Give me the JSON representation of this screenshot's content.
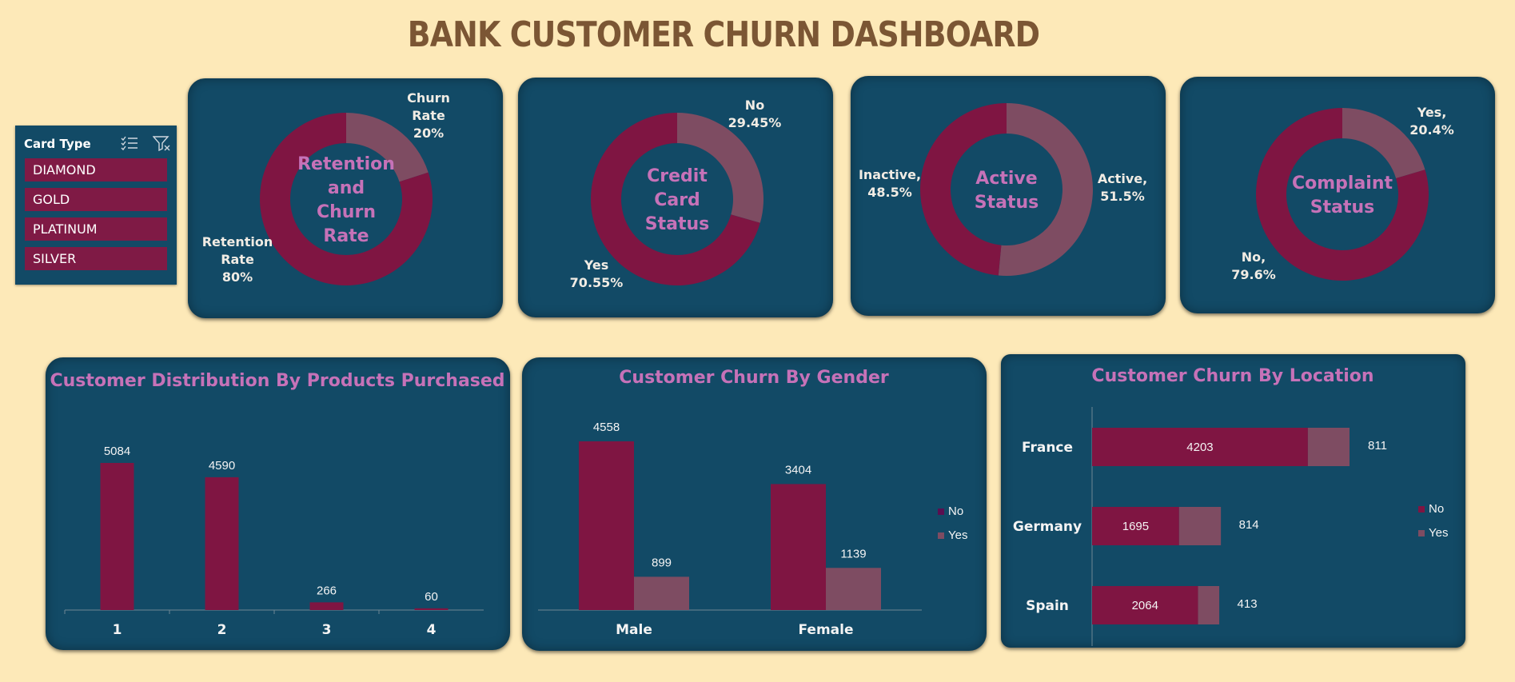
{
  "dashboard": {
    "title": "BANK CUSTOMER CHURN DASHBOARD"
  },
  "colors": {
    "no": "#7f1542",
    "yes": "#7e4c62",
    "panel": "#124a66",
    "accent": "#c672b8",
    "background": "#fde9b8"
  },
  "slicer": {
    "title": "Card Type",
    "icons": [
      "multi-select-icon",
      "clear-filter-icon"
    ],
    "items": [
      "DIAMOND",
      "GOLD",
      "PLATINUM",
      "SILVER"
    ]
  },
  "chart_data": [
    {
      "type": "pie",
      "center_title": [
        "Retention",
        "and",
        "Churn",
        "Rate"
      ],
      "slices": [
        {
          "name": "Churn Rate",
          "value": 20,
          "label_lines": [
            "Churn",
            "Rate",
            "20%"
          ]
        },
        {
          "name": "Retention Rate",
          "value": 80,
          "label_lines": [
            "Retention",
            "Rate",
            "80%"
          ]
        }
      ]
    },
    {
      "type": "pie",
      "center_title": [
        "Credit",
        "Card",
        "Status"
      ],
      "slices": [
        {
          "name": "No",
          "value": 29.45,
          "label_lines": [
            "No",
            "29.45%"
          ]
        },
        {
          "name": "Yes",
          "value": 70.55,
          "label_lines": [
            "Yes",
            "70.55%"
          ]
        }
      ]
    },
    {
      "type": "pie",
      "center_title": [
        "Active",
        "Status"
      ],
      "slices": [
        {
          "name": "Active",
          "value": 51.5,
          "label_lines": [
            "Active,",
            "51.5%"
          ]
        },
        {
          "name": "Inactive",
          "value": 48.5,
          "label_lines": [
            "Inactive,",
            "48.5%"
          ]
        }
      ]
    },
    {
      "type": "pie",
      "center_title": [
        "Complaint",
        "Status"
      ],
      "slices": [
        {
          "name": "Yes",
          "value": 20.4,
          "label_lines": [
            "Yes,",
            "20.4%"
          ]
        },
        {
          "name": "No",
          "value": 79.6,
          "label_lines": [
            "No,",
            "79.6%"
          ]
        }
      ]
    },
    {
      "type": "bar",
      "title": "Customer Distribution By Products Purchased",
      "categories": [
        "1",
        "2",
        "3",
        "4"
      ],
      "values": [
        5084,
        4590,
        266,
        60
      ],
      "ylim": [
        0,
        5084
      ]
    },
    {
      "type": "bar",
      "title": "Customer Churn By Gender",
      "categories": [
        "Male",
        "Female"
      ],
      "series": [
        {
          "name": "No",
          "values": [
            4558,
            3404
          ]
        },
        {
          "name": "Yes",
          "values": [
            899,
            1139
          ]
        }
      ],
      "ylim": [
        0,
        4558
      ],
      "legend": "right"
    },
    {
      "type": "bar",
      "orientation": "horizontal",
      "stacked": true,
      "title": "Customer Churn By Location",
      "categories": [
        "France",
        "Germany",
        "Spain"
      ],
      "series": [
        {
          "name": "No",
          "values": [
            4203,
            1695,
            2064
          ]
        },
        {
          "name": "Yes",
          "values": [
            811,
            814,
            413
          ]
        }
      ],
      "legend": "right"
    }
  ]
}
